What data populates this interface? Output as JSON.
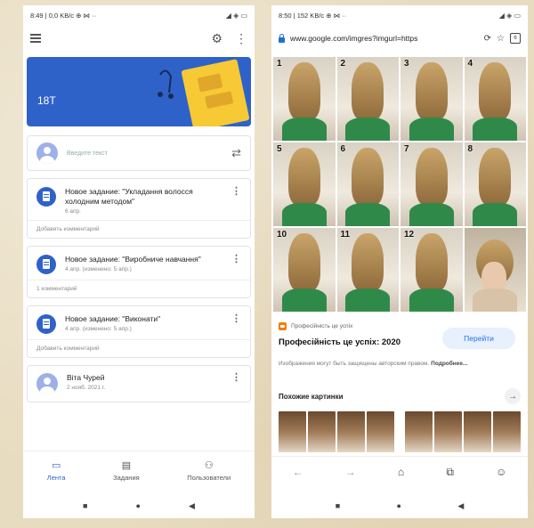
{
  "left_phone": {
    "status": {
      "left": "8:49 | 0,0 KB/c ⊕ ⋈ ··",
      "right": "◢ ◈ ▭"
    },
    "banner_title": "18T",
    "announce_placeholder": "Введите текст",
    "tasks": [
      {
        "title": "Новое задание: \"Укладання волосся холодним методом\"",
        "date": "6 апр.",
        "footer": "Добавить комментарий"
      },
      {
        "title": "Новое задание: \"Виробниче навчання\"",
        "date": "4 апр. (изменено: 5 апр.)",
        "footer": "1 комментарий"
      },
      {
        "title": "Новое задание: \"Виконати\"",
        "date": "4 апр. (изменено: 5 апр.)",
        "footer": "Добавить комментарий"
      }
    ],
    "person": {
      "name": "Віта Чурей",
      "date": "2 нояб. 2021 г."
    },
    "nav": {
      "feed": "Лента",
      "tasks": "Задания",
      "users": "Пользователи"
    },
    "sysnav": {
      "recent": "■",
      "home": "●",
      "back": "◀"
    }
  },
  "right_phone": {
    "status": {
      "left": "8:50 | 152 KB/c ⊕ ⋈ ··",
      "right": "◢ ◈ ▭"
    },
    "url": "www.google.com/imgres?imgurl=https",
    "tab_count": "6",
    "images": [
      "1",
      "2",
      "3",
      "4",
      "5",
      "6",
      "7",
      "8",
      "10",
      "11",
      "12"
    ],
    "source_name": "Професійність це успіх",
    "image_title": "Професійність це успіх: 2020",
    "go_button": "Перейти",
    "copyright": "Изображения могут быть защищены авторским правом.",
    "details_link": "Подробнее...",
    "similar_label": "Похожие картинки",
    "icons": {
      "refresh": "⟳",
      "star": "☆",
      "back": "←",
      "forward": "→",
      "home": "⌂",
      "tabs": "⧉",
      "profile": "☺"
    }
  }
}
